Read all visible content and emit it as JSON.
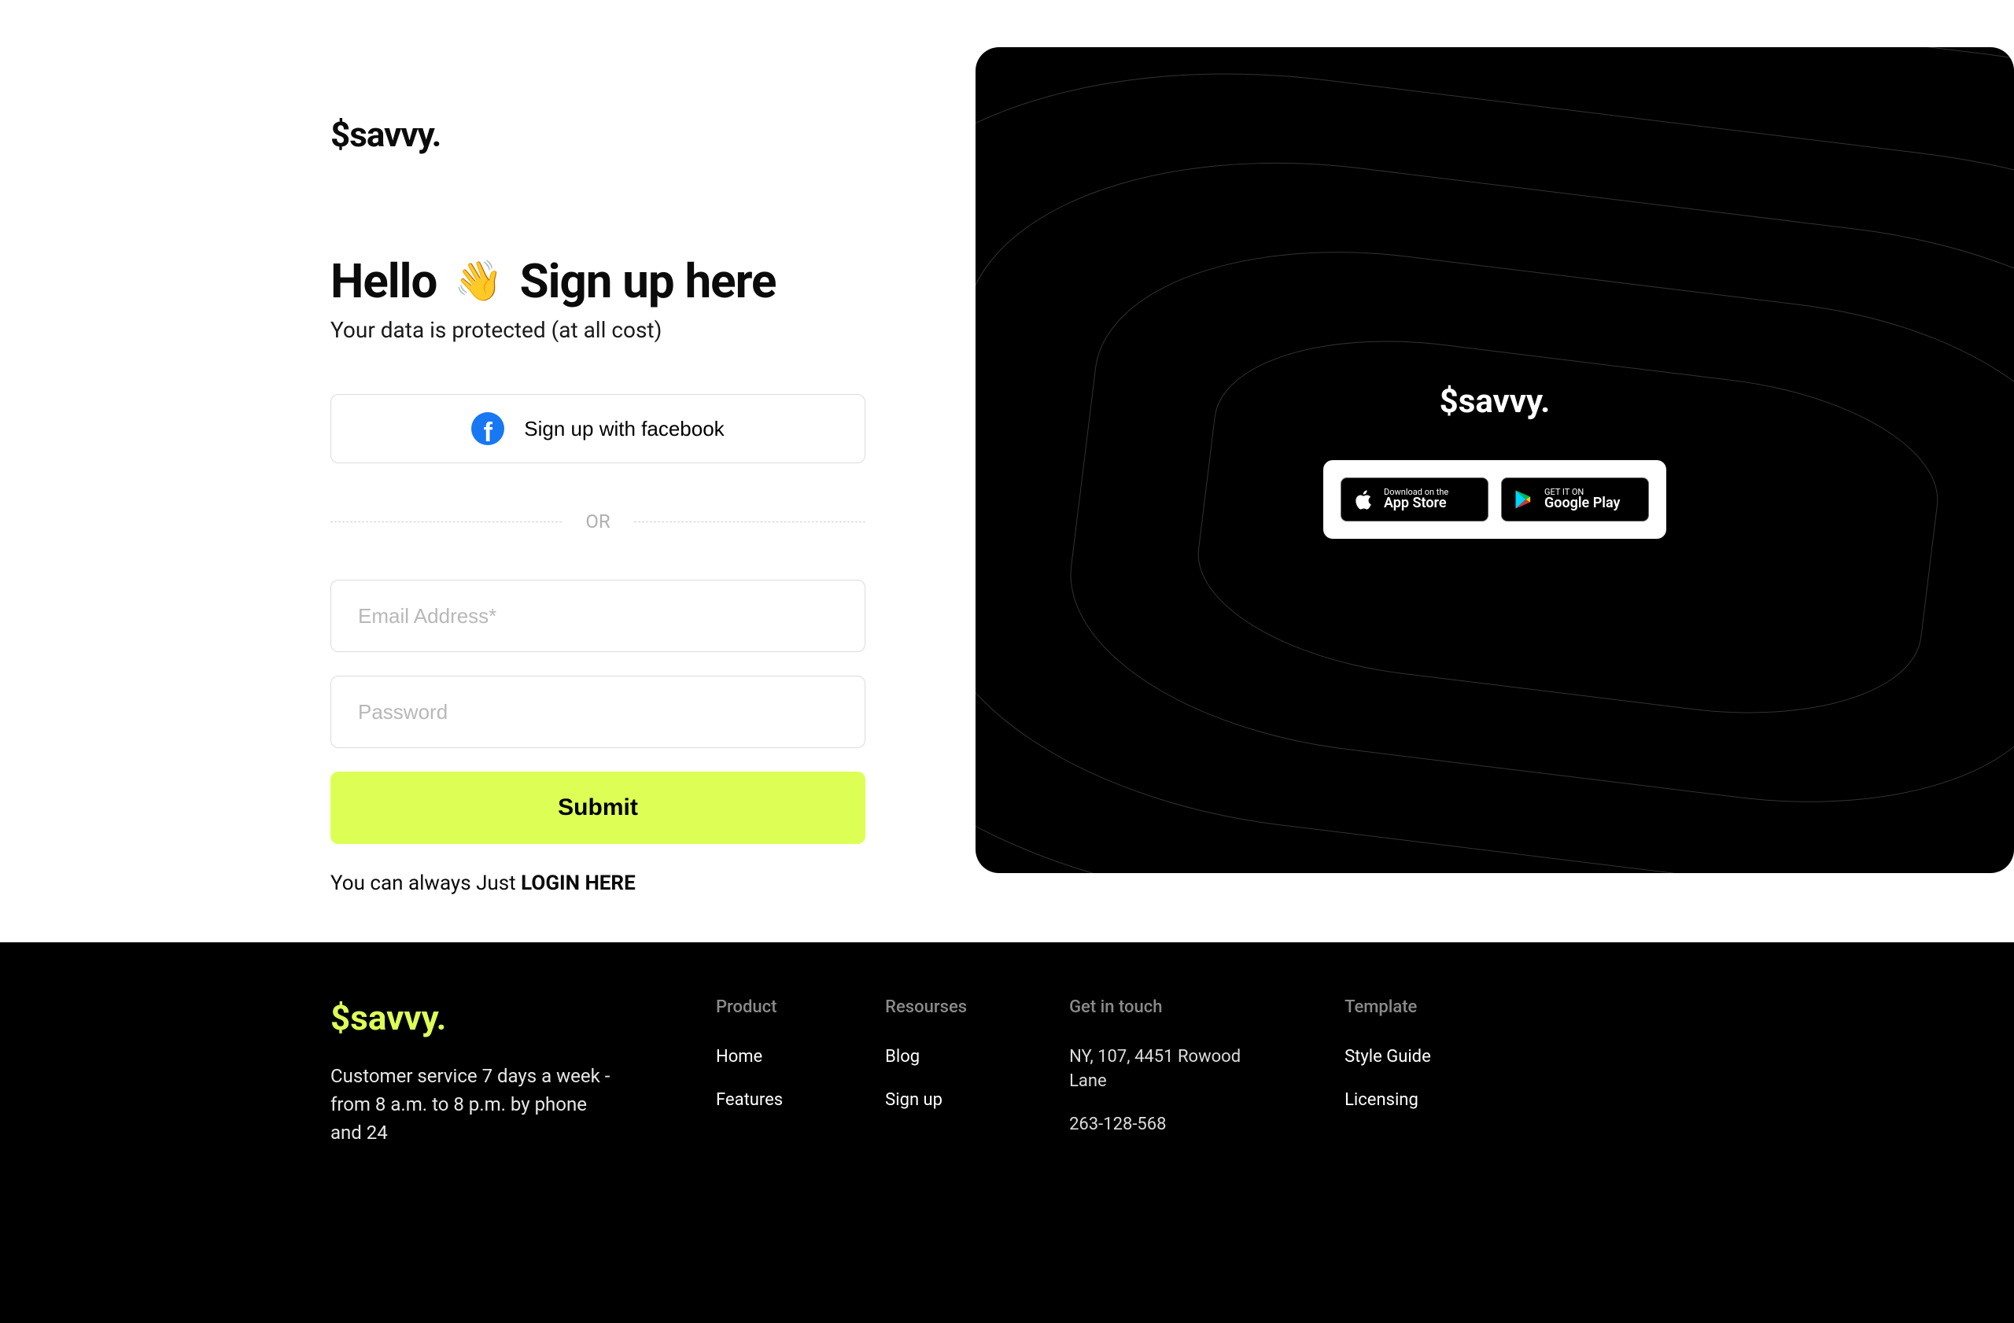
{
  "brand": "$savvy.",
  "h1a": "Hello",
  "h1b": "Sign up here",
  "tagline": "Your data is protected (at all cost)",
  "fb_label": "Sign up with facebook",
  "or": "OR",
  "email_ph": "Email Address*",
  "pw_ph": "Password",
  "submit": "Submit",
  "login_lead": "You can always Just ",
  "login_link": "LOGIN HERE",
  "app_small": "Download on the",
  "app_big": "App Store",
  "play_small": "GET IT ON",
  "play_big": "Google Play",
  "footer_about": "Customer service 7 days a week - from 8 a.m. to 8 p.m. by phone and 24",
  "footer_cols": {
    "product": {
      "title": "Product",
      "links": [
        "Home",
        "Features"
      ]
    },
    "resources": {
      "title": "Resourses",
      "links": [
        "Blog",
        "Sign up"
      ]
    },
    "touch": {
      "title": "Get in touch",
      "lines": [
        "NY, 107, 4451 Rowood Lane",
        "263-128-568"
      ]
    },
    "template": {
      "title": "Template",
      "links": [
        "Style Guide",
        "Licensing"
      ]
    }
  }
}
